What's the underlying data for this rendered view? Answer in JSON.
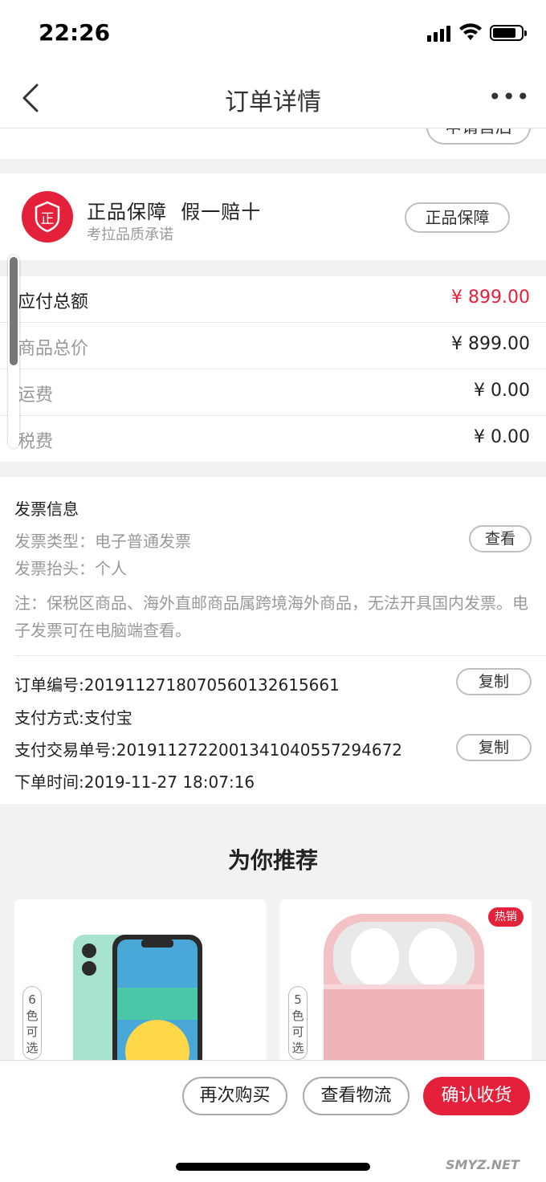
{
  "status_bar": {
    "time": "22:26"
  },
  "nav": {
    "title": "订单详情",
    "back_icon": "chevron-left-icon",
    "more_label": "•••"
  },
  "after_sale": {
    "label": "申请售后"
  },
  "guarantee": {
    "title": "正品保障  假一赔十",
    "subtitle": "考拉品质承诺",
    "button": "正品保障",
    "logo_text": "正",
    "brand_color": "#e5203a"
  },
  "totals": [
    {
      "label": "应付总额",
      "value": "¥ 899.00"
    },
    {
      "label": "商品总价",
      "value": "¥ 899.00"
    },
    {
      "label": "运费",
      "value": "¥ 0.00"
    },
    {
      "label": "税费",
      "value": "¥ 0.00"
    }
  ],
  "invoice": {
    "title": "发票信息",
    "type": "发票类型：电子普通发票",
    "header": "发票抬头：个人",
    "view_button": "查看",
    "note": "注：保税区商品、海外直邮商品属跨境海外商品，无法开具国内发票。电子发票可在电脑端查看。"
  },
  "order": {
    "number": "订单编号:2019112718070560132615661",
    "payment_method": "支付方式:支付宝",
    "trade_number": "支付交易单号:2019112722001341040557294672",
    "order_time": "下单时间:2019-11-27 18:07:16",
    "copy_label": "复制"
  },
  "recommend": {
    "title": "为你推荐",
    "items": [
      {
        "color_tag": "6色可选",
        "image": "phone-image"
      },
      {
        "color_tag": "5色可选",
        "image": "earbuds-case-image",
        "badge": "热销"
      }
    ]
  },
  "bottom_bar": {
    "rebuy": "再次购买",
    "logistics": "查看物流",
    "confirm": "确认收货"
  },
  "watermark": "SMYZ.NET"
}
